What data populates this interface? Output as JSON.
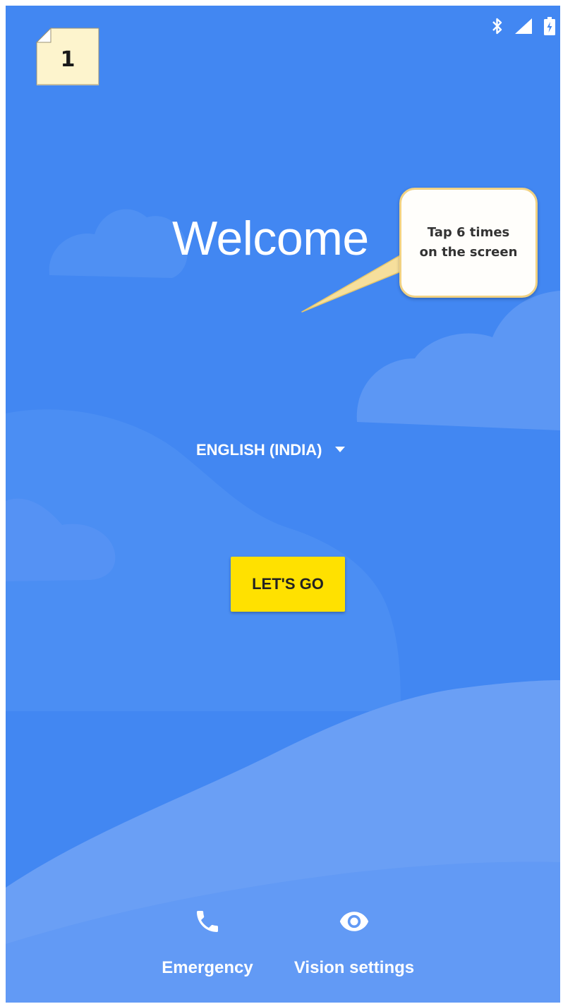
{
  "status_bar": {
    "icons": [
      "bluetooth-icon",
      "cellular-signal-icon",
      "battery-charging-icon"
    ]
  },
  "step_note": {
    "number": "1"
  },
  "welcome": {
    "title": "Welcome"
  },
  "callout": {
    "line1": "Tap 6 times",
    "line2": "on the screen"
  },
  "language": {
    "selected": "ENGLISH (INDIA)",
    "icon": "dropdown-arrow-icon"
  },
  "primary_button": {
    "label": "LET'S GO"
  },
  "bottom_actions": [
    {
      "label": "Emergency",
      "icon": "phone-icon"
    },
    {
      "label": "Vision settings",
      "icon": "eye-icon"
    }
  ],
  "colors": {
    "background": "#4287f2",
    "button": "#ffe100",
    "cloud_light": "#6a9ff5",
    "callout_border": "#f1d283",
    "note_fill": "#fdf4cd"
  }
}
